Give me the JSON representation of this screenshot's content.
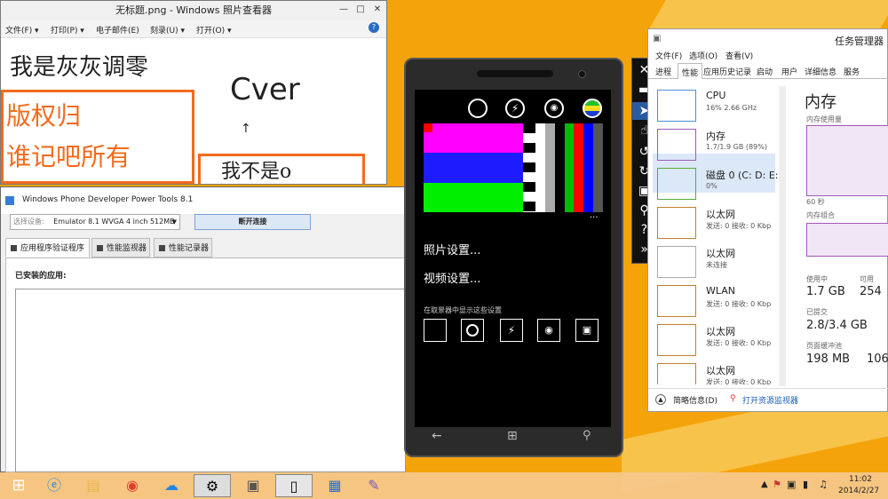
{
  "photo_viewer": {
    "title": "无标题.png - Windows 照片查看器",
    "menu": [
      "文件(F) ▾",
      "打印(P) ▾",
      "电子邮件(E)",
      "刻录(U) ▾",
      "打开(O) ▾"
    ],
    "handwriting": [
      "我是灰灰调零",
      "Cver",
      "版权归",
      "谁记吧所有",
      "我不是o"
    ]
  },
  "power_tools": {
    "title": "Windows Phone Developer Power Tools 8.1",
    "select_label": "选择设备:",
    "device": "Emulator 8.1 WVGA 4 inch 512MB",
    "disconnect": "断开连接",
    "tabs": [
      "应用程序验证程序",
      "性能监视器",
      "性能记录器"
    ],
    "installed_label": "已安装的应用:"
  },
  "phone": {
    "settings": [
      "照片设置...",
      "视频设置..."
    ],
    "viewfinder_label": "在取景器中显示这些设置",
    "more": "..."
  },
  "task_manager": {
    "title": "任务管理器",
    "menu": [
      "文件(F)",
      "选项(O)",
      "查看(V)"
    ],
    "tabs": [
      "进程",
      "性能",
      "应用历史记录",
      "启动",
      "用户",
      "详细信息",
      "服务"
    ],
    "resources": [
      {
        "name": "CPU",
        "stat": "16% 2.66 GHz"
      },
      {
        "name": "内存",
        "stat": "1.7/1.9 GB (89%)"
      },
      {
        "name": "磁盘 0 (C: D: E:",
        "stat": "0%"
      },
      {
        "name": "以太网",
        "stat": "发送: 0 接收: 0 Kbp"
      },
      {
        "name": "以太网",
        "stat": "未连接"
      },
      {
        "name": "WLAN",
        "stat": "发送: 0 接收: 0 Kbp"
      },
      {
        "name": "以太网",
        "stat": "发送: 0 接收: 0 Kbp"
      },
      {
        "name": "以太网",
        "stat": "发送: 0 接收: 0 Kbp"
      }
    ],
    "detail": {
      "heading": "内存",
      "usage_label": "内存使用量",
      "time_label": "60 秒",
      "composition_label": "内存组合",
      "in_use_label": "使用中",
      "in_use": "1.7 GB",
      "available_label": "可用",
      "available": "254",
      "committed_label": "已提交",
      "committed": "2.8/3.4 GB",
      "paged_label": "页面缓冲池",
      "paged": "198 MB",
      "nonpaged": "106"
    },
    "footer": {
      "summary": "简略信息(D)",
      "monitor": "打开资源监视器"
    }
  },
  "taskbar": {
    "time": "11:02",
    "date": "2014/2/27"
  }
}
